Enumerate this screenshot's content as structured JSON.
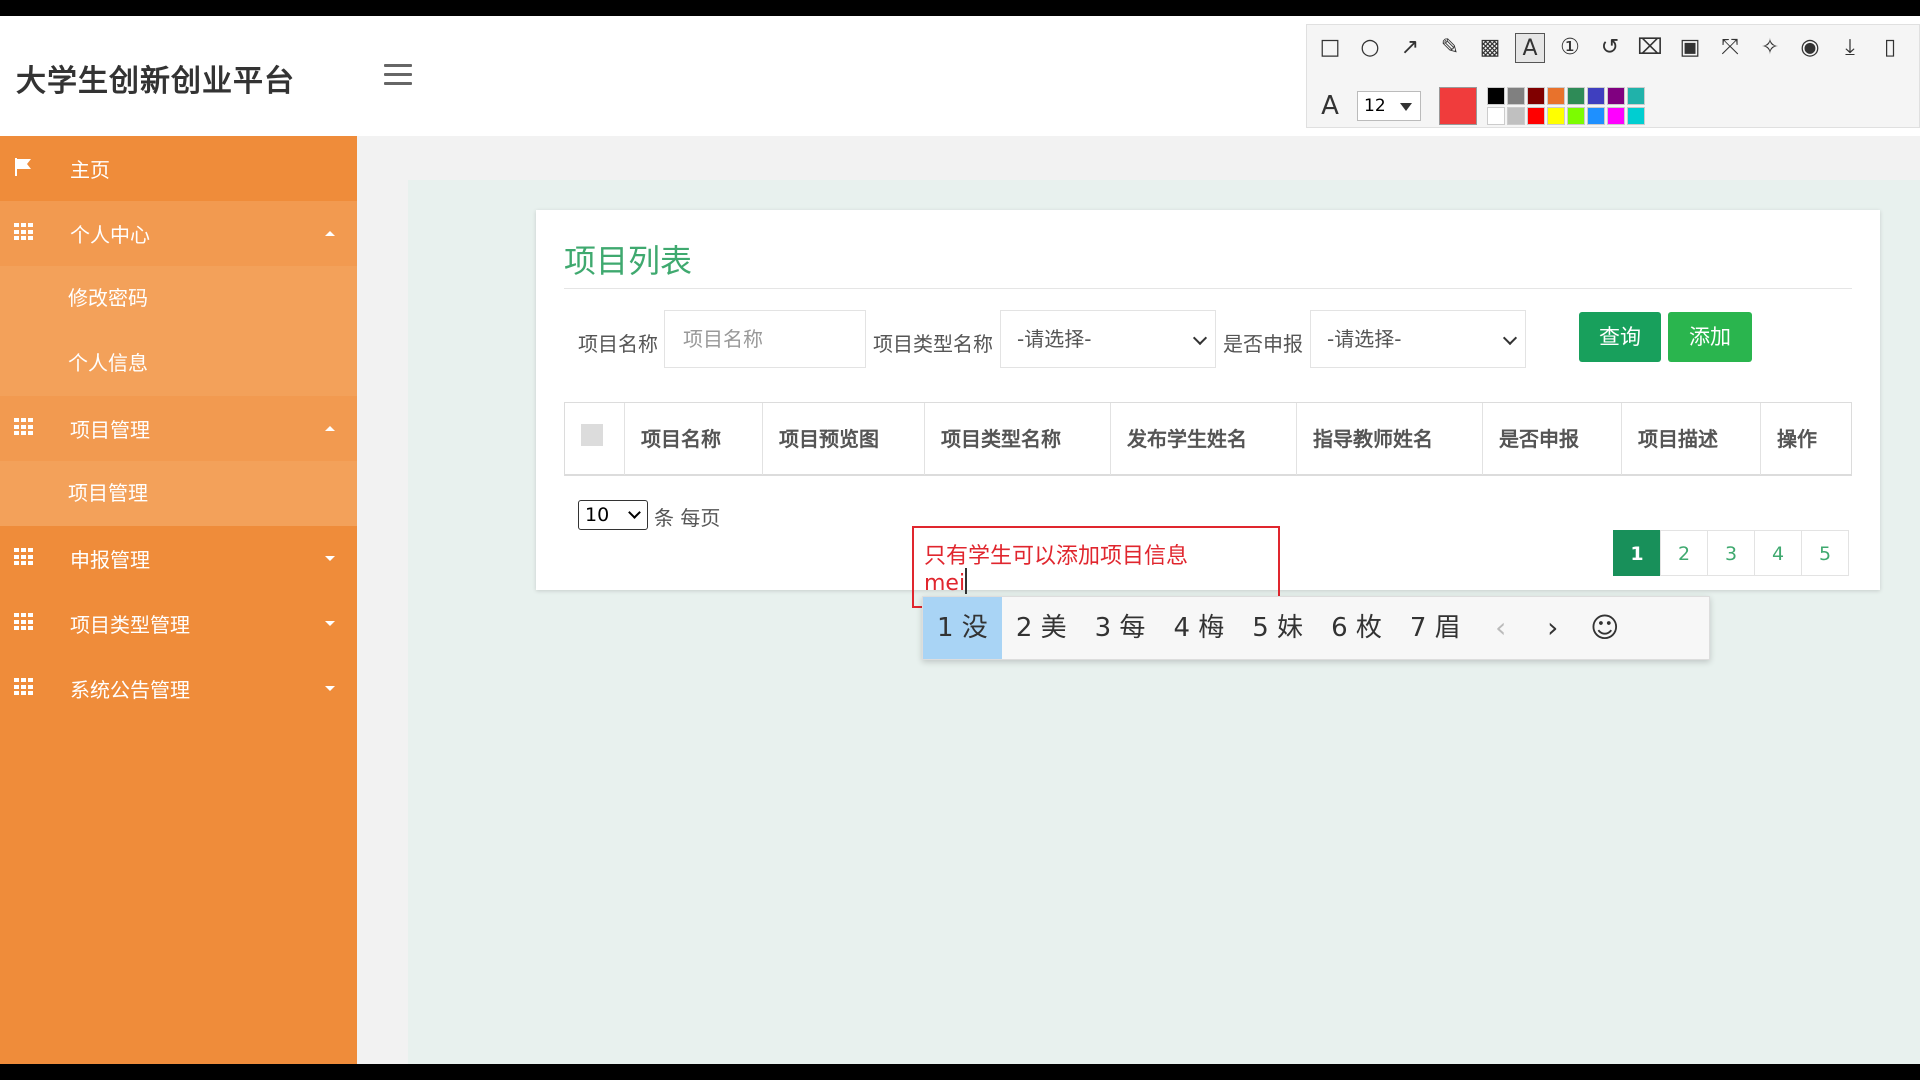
{
  "app": {
    "title": "大学生创新创业平台"
  },
  "sidebar": {
    "home": "主页",
    "groups": [
      {
        "label": "个人中心",
        "open": true,
        "items": [
          "修改密码",
          "个人信息"
        ]
      },
      {
        "label": "项目管理",
        "open": true,
        "items": [
          "项目管理"
        ]
      },
      {
        "label": "申报管理",
        "open": false,
        "items": []
      },
      {
        "label": "项目类型管理",
        "open": false,
        "items": []
      },
      {
        "label": "系统公告管理",
        "open": false,
        "items": []
      }
    ]
  },
  "toolbar": {
    "tools": [
      "rectangle-icon",
      "ellipse-icon",
      "arrow-icon",
      "pencil-icon",
      "mosaic-icon",
      "text-icon",
      "number-icon",
      "undo-icon",
      "clear-icon",
      "translate-icon",
      "fullscreen-icon",
      "pin-icon",
      "record-icon",
      "download-icon",
      "save-icon"
    ],
    "font_size": "12",
    "current_color": "#f03c3c",
    "palette": [
      "#000000",
      "#808080",
      "#800000",
      "#e8722c",
      "#2e8b57",
      "#3f3fbf",
      "#800080",
      "#20b2aa",
      "#ffffff",
      "#c0c0c0",
      "#ff0000",
      "#ffff00",
      "#7cfc00",
      "#1e90ff",
      "#ff00ff",
      "#00ced1"
    ]
  },
  "main": {
    "card_title": "项目列表",
    "filters": {
      "name_label": "项目名称",
      "name_placeholder": "项目名称",
      "type_label": "项目类型名称",
      "type_value": "-请选择-",
      "declared_label": "是否申报",
      "declared_value": "-请选择-",
      "query_btn": "查询",
      "add_btn": "添加"
    },
    "table": {
      "headers": [
        "项目名称",
        "项目预览图",
        "项目类型名称",
        "发布学生姓名",
        "指导教师姓名",
        "是否申报",
        "项目描述",
        "操作"
      ]
    },
    "page_size": "10",
    "per_page_text": "条 每页",
    "pages": [
      "1",
      "2",
      "3",
      "4",
      "5"
    ],
    "active_page": "1"
  },
  "annotation": {
    "line1": "只有学生可以添加项目信息",
    "line2": "mei"
  },
  "ime": {
    "candidates": [
      "1 没",
      "2 美",
      "3 每",
      "4 梅",
      "5 妹",
      "6 枚",
      "7 眉"
    ]
  }
}
